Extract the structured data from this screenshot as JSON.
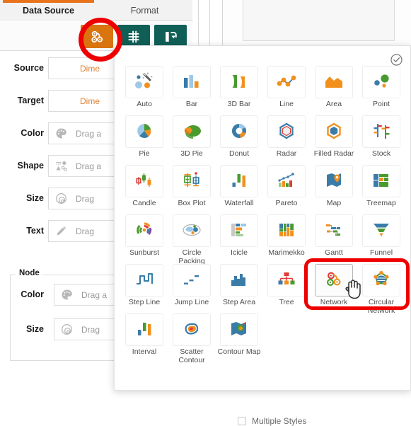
{
  "app": {
    "tabs": [
      {
        "label": "Data Source",
        "active": true
      },
      {
        "label": "Format",
        "active": false
      }
    ],
    "toolbar": {
      "buttons": [
        {
          "name": "network-chart-button",
          "icon": "network-icon",
          "active": true
        },
        {
          "name": "axis-settings-button",
          "icon": "axis-icon",
          "active": false
        },
        {
          "name": "swap-axes-button",
          "icon": "swap-icon",
          "active": false
        }
      ]
    }
  },
  "fields": {
    "shelves": [
      {
        "label": "Source",
        "value": "Dime",
        "placeholder": "Dimension",
        "icon": "none",
        "kind": "dim"
      },
      {
        "label": "Target",
        "value": "Dime",
        "placeholder": "Dimension",
        "icon": "none",
        "kind": "dim"
      },
      {
        "label": "Color",
        "value": "Drag a",
        "placeholder": "Drag and drop",
        "icon": "palette-icon",
        "kind": "drop"
      },
      {
        "label": "Shape",
        "value": "Drag a",
        "placeholder": "Drag and drop",
        "icon": "shape-icon",
        "kind": "drop"
      },
      {
        "label": "Size",
        "value": "Drag",
        "placeholder": "Drag and drop",
        "icon": "size-icon",
        "kind": "drop"
      },
      {
        "label": "Text",
        "value": "Drag",
        "placeholder": "Drag and drop",
        "icon": "pencil-icon",
        "kind": "drop"
      }
    ],
    "node_group": {
      "legend": "Node",
      "shelves": [
        {
          "label": "Color",
          "value": "Drag a",
          "placeholder": "Drag and drop",
          "icon": "palette-icon",
          "kind": "drop"
        },
        {
          "label": "Size",
          "value": "Drag",
          "placeholder": "Drag and drop",
          "icon": "size-icon",
          "kind": "drop"
        }
      ]
    }
  },
  "chart_panel": {
    "confirm_icon": "check-circle-icon",
    "multiple_styles": {
      "label": "Multiple Styles",
      "checked": false
    },
    "selected": "Network",
    "hovered": "Network",
    "tiles": [
      {
        "label": "Auto",
        "icon": "auto-icon"
      },
      {
        "label": "Bar",
        "icon": "bar-icon"
      },
      {
        "label": "3D Bar",
        "icon": "bar3d-icon"
      },
      {
        "label": "Line",
        "icon": "line-icon"
      },
      {
        "label": "Area",
        "icon": "area-icon"
      },
      {
        "label": "Point",
        "icon": "point-icon"
      },
      {
        "label": "Pie",
        "icon": "pie-icon"
      },
      {
        "label": "3D Pie",
        "icon": "pie3d-icon"
      },
      {
        "label": "Donut",
        "icon": "donut-icon"
      },
      {
        "label": "Radar",
        "icon": "radar-icon"
      },
      {
        "label": "Filled Radar",
        "icon": "filled-radar-icon"
      },
      {
        "label": "Stock",
        "icon": "stock-icon"
      },
      {
        "label": "Candle",
        "icon": "candle-icon"
      },
      {
        "label": "Box Plot",
        "icon": "boxplot-icon"
      },
      {
        "label": "Waterfall",
        "icon": "waterfall-icon"
      },
      {
        "label": "Pareto",
        "icon": "pareto-icon"
      },
      {
        "label": "Map",
        "icon": "map-icon"
      },
      {
        "label": "Treemap",
        "icon": "treemap-icon"
      },
      {
        "label": "Sunburst",
        "icon": "sunburst-icon"
      },
      {
        "label": "Circle Packing",
        "icon": "circle-packing-icon"
      },
      {
        "label": "Icicle",
        "icon": "icicle-icon"
      },
      {
        "label": "Marimekko",
        "icon": "marimekko-icon"
      },
      {
        "label": "Gantt",
        "icon": "gantt-icon"
      },
      {
        "label": "Funnel",
        "icon": "funnel-icon"
      },
      {
        "label": "Step Line",
        "icon": "step-line-icon"
      },
      {
        "label": "Jump Line",
        "icon": "jump-line-icon"
      },
      {
        "label": "Step Area",
        "icon": "step-area-icon"
      },
      {
        "label": "Tree",
        "icon": "tree-icon"
      },
      {
        "label": "Network",
        "icon": "network-icon"
      },
      {
        "label": "Circular Network",
        "icon": "circular-network-icon"
      },
      {
        "label": "Interval",
        "icon": "interval-icon"
      },
      {
        "label": "Scatter Contour",
        "icon": "scatter-contour-icon"
      },
      {
        "label": "Contour Map",
        "icon": "contour-map-icon"
      }
    ]
  },
  "colors": {
    "accent_orange": "#e8731a",
    "toolbar_active": "#d9740f",
    "toolbar_teal": "#0f5f57",
    "annotation_red": "#ee0000",
    "blue": "#3a7ca8",
    "orange": "#f2901e",
    "green": "#4a9b2f",
    "light_blue": "#9dc9e8",
    "red": "#e03b35"
  }
}
